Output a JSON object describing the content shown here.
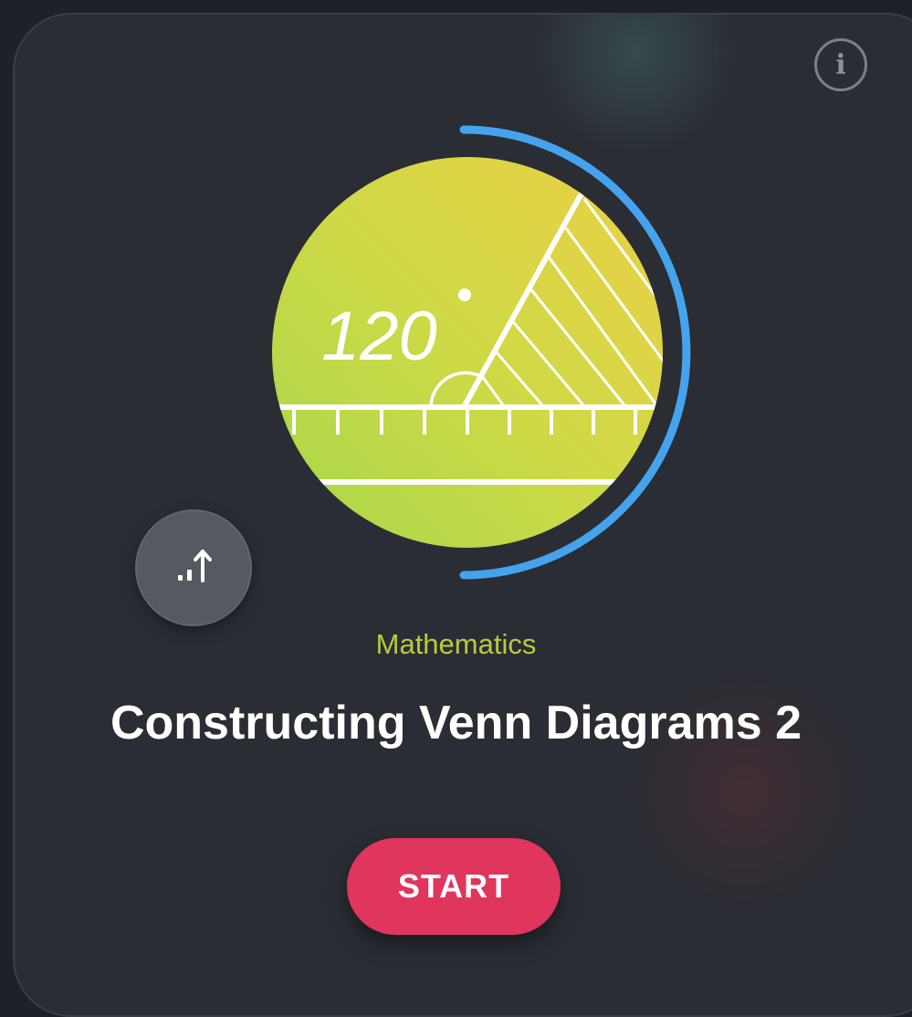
{
  "card": {
    "info_icon_glyph": "i",
    "illustration_angle_text": "120",
    "subject": "Mathematics",
    "title": "Constructing Venn Diagrams 2",
    "start_label": "START",
    "progress_icon": "level-up-icon",
    "colors": {
      "card_background": "#2a2d34",
      "subject": "#b5cc3d",
      "start_button": "#e0355c",
      "progress_arc": "#45a3ee",
      "illustration_gradient_start": "#e9d247",
      "illustration_gradient_end": "#a8d84a"
    }
  }
}
